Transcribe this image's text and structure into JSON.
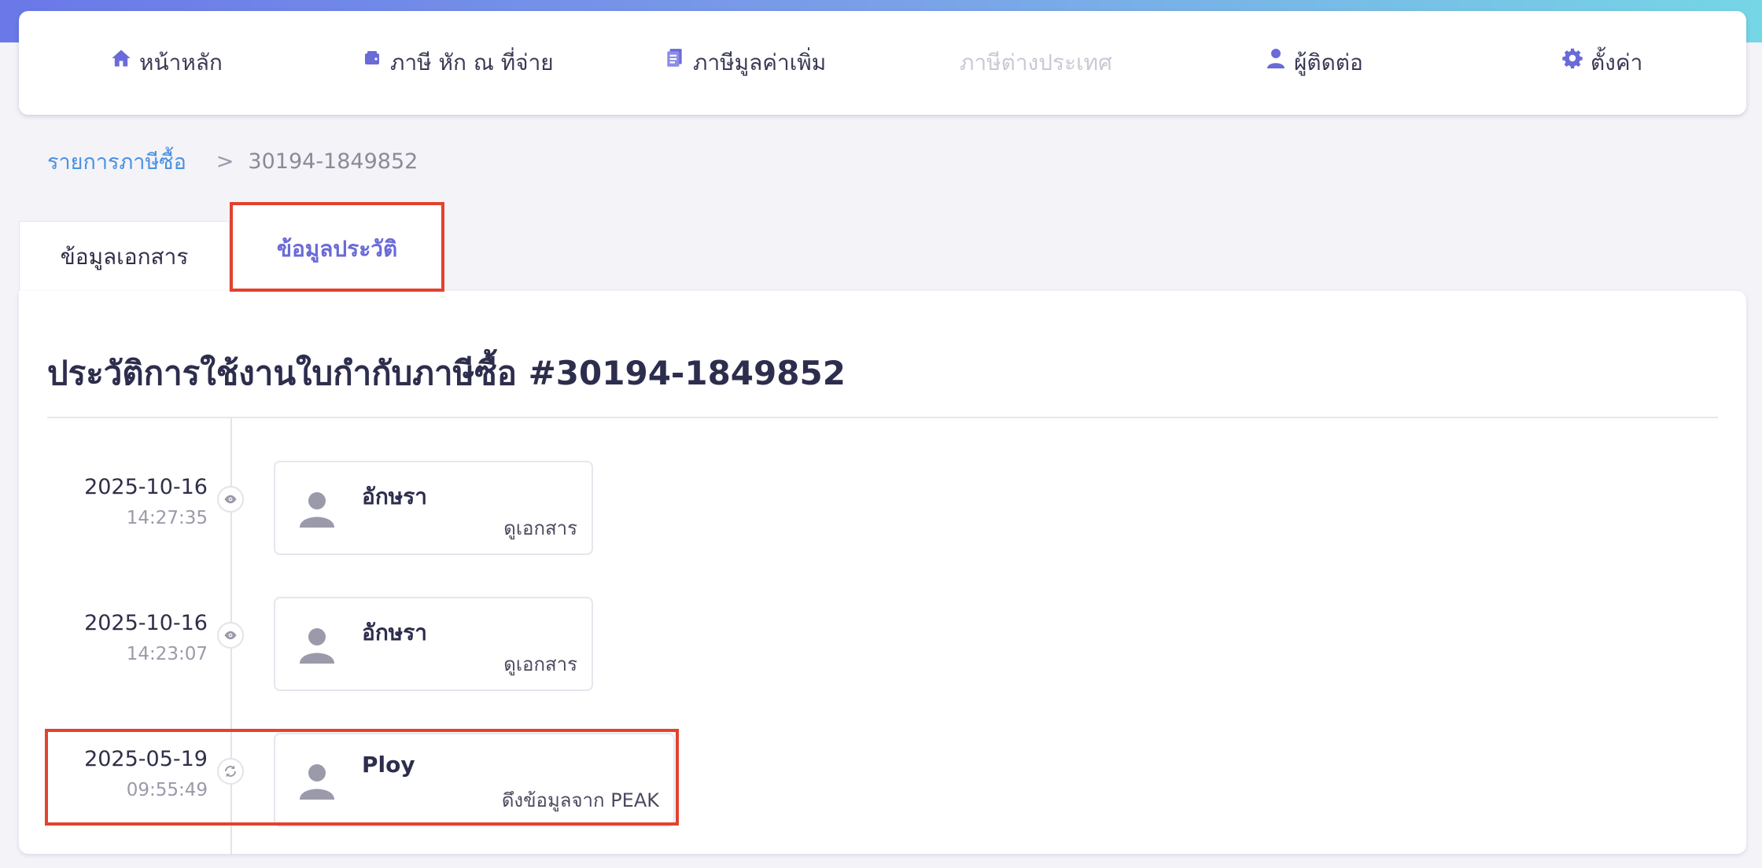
{
  "nav": {
    "items": [
      {
        "label": "หน้าหลัก",
        "icon": "home-icon",
        "disabled": false
      },
      {
        "label": "ภาษี หัก ณ ที่จ่าย",
        "icon": "wallet-icon",
        "disabled": false
      },
      {
        "label": "ภาษีมูลค่าเพิ่ม",
        "icon": "receipt-icon",
        "disabled": false
      },
      {
        "label": "ภาษีต่างประเทศ",
        "icon": "",
        "disabled": true
      },
      {
        "label": "ผู้ติดต่อ",
        "icon": "user-icon",
        "disabled": false
      },
      {
        "label": "ตั้งค่า",
        "icon": "gear-icon",
        "disabled": false
      }
    ]
  },
  "breadcrumb": {
    "parent": "รายการภาษีซื้อ",
    "separator": ">",
    "current": "30194-1849852"
  },
  "tabs": {
    "document_info": "ข้อมูลเอกสาร",
    "history": "ข้อมูลประวัติ"
  },
  "panel": {
    "title": "ประวัติการใช้งานใบกำกับภาษีซื้อ #30194-1849852"
  },
  "timeline": [
    {
      "date": "2025-10-16",
      "time": "14:27:35",
      "name": "อักษรา",
      "action": "ดูเอกสาร",
      "icon": "eye-icon"
    },
    {
      "date": "2025-10-16",
      "time": "14:23:07",
      "name": "อักษรา",
      "action": "ดูเอกสาร",
      "icon": "eye-icon"
    },
    {
      "date": "2025-05-19",
      "time": "09:55:49",
      "name": "Ploy",
      "action": "ดึงข้อมูลจาก PEAK",
      "icon": "sync-icon"
    }
  ],
  "colors": {
    "accent": "#6a6ad8",
    "link": "#4a90e2",
    "highlight": "#e2422e"
  }
}
